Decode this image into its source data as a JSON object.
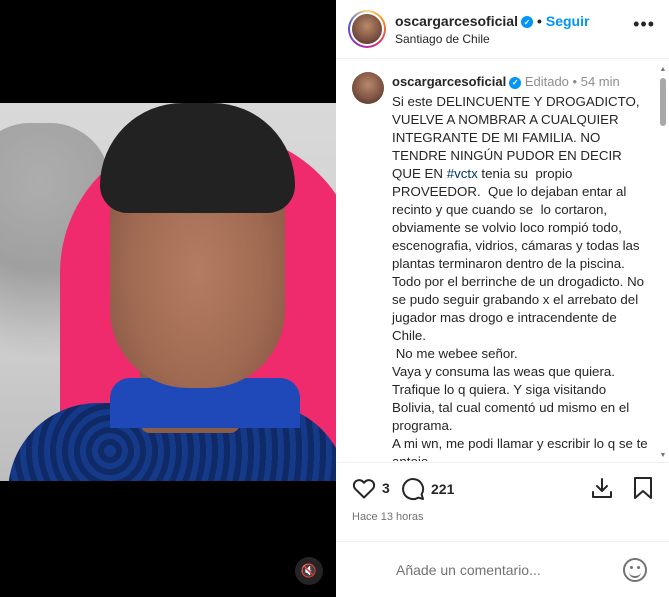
{
  "header": {
    "username": "oscargarcesoficial",
    "follow_label": "Seguir",
    "location": "Santiago de Chile",
    "more_icon": "more-icon"
  },
  "caption": {
    "username": "oscargarcesoficial",
    "edited_label": "Editado",
    "time": "54 min",
    "text_before_tag": "Si este DELINCUENTE Y DROGADICTO, VUELVE A NOMBRAR A CUALQUIER INTEGRANTE DE MI FAMILIA. NO TENDRE NINGÚN PUDOR EN DECIR QUE EN ",
    "hashtag": "#vctx",
    "text_after_tag": " tenia su  propio PROVEEDOR.  Que lo dejaban entar al recinto y que cuando se  lo cortaron, obviamente se volvio loco rompió todo, escenografia, vidrios, cámaras y todas las plantas terminaron dentro de la piscina. Todo por el berrinche de un drogadicto. No se pudo seguir grabando x el arrebato del  jugador mas drogo e intracendente de Chile.\n No me webee señor.\nVaya y consuma las weas que quiera. Trafique lo q quiera. Y siga visitando Bolivia, tal cual comentó ud mismo en el programa.\nA mi wn, me podi llamar y escribir lo q se te antoje."
  },
  "actions": {
    "likes": "3",
    "comments": "221",
    "posted": "Hace 13 horas"
  },
  "add_comment": {
    "placeholder": "Añade un comentario..."
  },
  "colors": {
    "accent": "#0095f6",
    "hashtag": "#00376b"
  }
}
